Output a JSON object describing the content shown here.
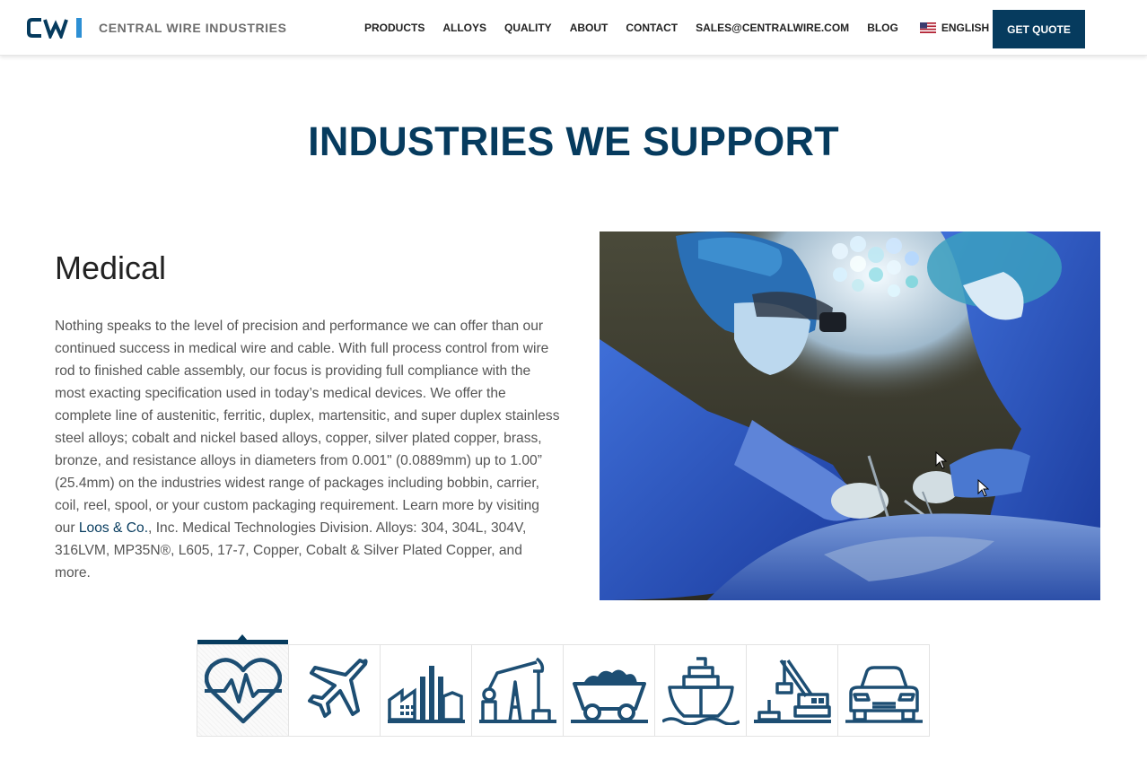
{
  "header": {
    "logo_mark_alt": "CWI",
    "logo_text": "CENTRAL WIRE INDUSTRIES",
    "nav": [
      "PRODUCTS",
      "ALLOYS",
      "QUALITY",
      "ABOUT",
      "CONTACT",
      "SALES@CENTRALWIRE.COM",
      "BLOG"
    ],
    "language": "ENGLISH",
    "cta": "GET QUOTE"
  },
  "page": {
    "title": "INDUSTRIES WE SUPPORT"
  },
  "industry": {
    "name": "Medical",
    "text_before_link": "Nothing speaks to the level of precision and performance we can offer than our continued success in medical wire and cable. With full process control from wire rod to finished cable assembly, our focus is providing full compliance with the most exacting specification used in today’s medical devices. We offer the complete line of austenitic, ferritic, duplex, martensitic, and super duplex stainless steel alloys; cobalt and nickel based alloys, copper, silver plated copper, brass, bronze, and resistance alloys in diameters from 0.001\" (0.0889mm) up to 1.00” (25.4mm) on the industries widest range of packages including bobbin, carrier, coil, reel, spool, or your custom packaging requirement. Learn more by visiting our ",
    "link_text": "Loos & Co.",
    "text_after_link": ", Inc. Medical Technologies Division. Alloys: 304, 304L, 304V, 316LVM, MP35N®, L605, 17-7, Copper, Cobalt & Silver Plated Copper, and more."
  },
  "industry_icons": [
    {
      "icon": "heart-pulse-icon",
      "active": true
    },
    {
      "icon": "airplane-icon",
      "active": false
    },
    {
      "icon": "factory-icon",
      "active": false
    },
    {
      "icon": "oil-pump-icon",
      "active": false
    },
    {
      "icon": "mining-cart-icon",
      "active": false
    },
    {
      "icon": "ship-icon",
      "active": false
    },
    {
      "icon": "crane-icon",
      "active": false
    },
    {
      "icon": "car-icon",
      "active": false
    }
  ],
  "colors": {
    "brand": "#063b5e",
    "text": "#555555",
    "icon": "#1d4e73"
  }
}
